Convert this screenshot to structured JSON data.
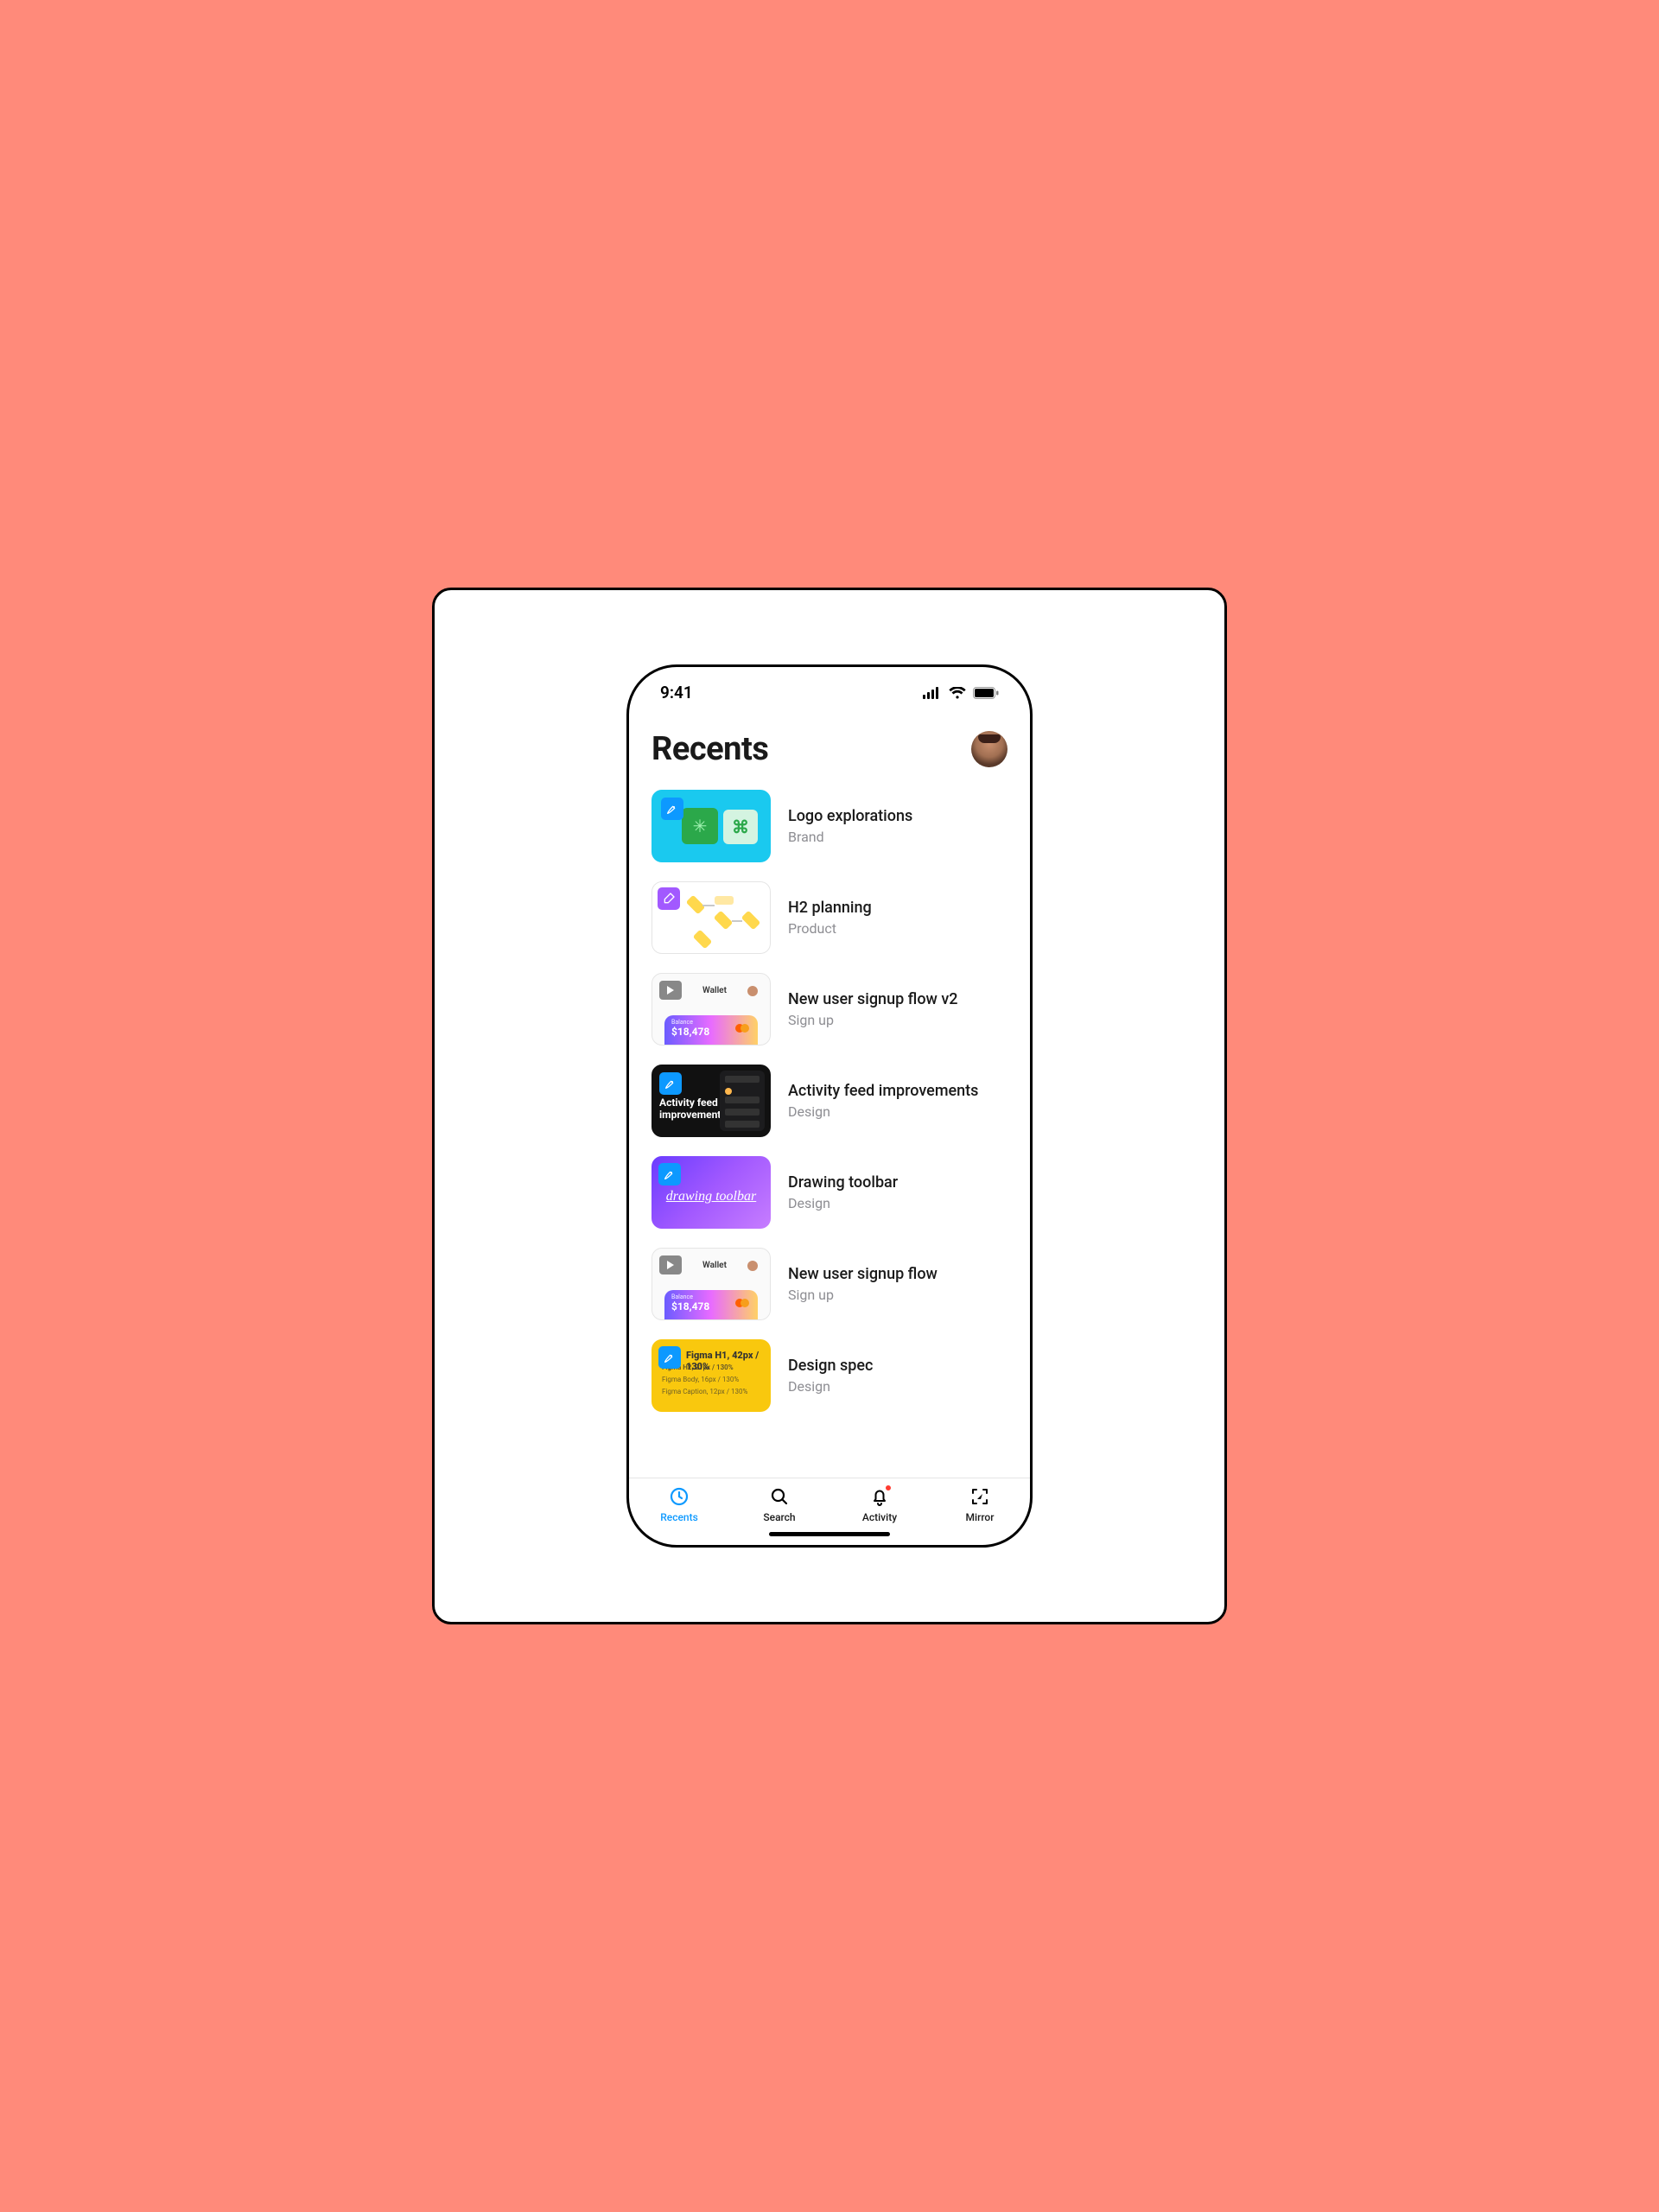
{
  "status": {
    "time": "9:41"
  },
  "header": {
    "title": "Recents"
  },
  "items": [
    {
      "title": "Logo explorations",
      "subtitle": "Brand"
    },
    {
      "title": "H2 planning",
      "subtitle": "Product"
    },
    {
      "title": "New user signup flow v2",
      "subtitle": "Sign up"
    },
    {
      "title": "Activity feed improvements",
      "subtitle": "Design"
    },
    {
      "title": "Drawing toolbar",
      "subtitle": "Design"
    },
    {
      "title": "New user signup flow",
      "subtitle": "Sign up"
    },
    {
      "title": "Design spec",
      "subtitle": "Design"
    }
  ],
  "thumb_text": {
    "wallet_label": "Wallet",
    "wallet_balance_label": "Balance",
    "wallet_amount": "$18,478",
    "activity_line1": "Activity feed",
    "activity_line2": "improvements",
    "drawing_script": "drawing toolbar",
    "spec_h1": "Figma H1, 42px / 130%",
    "spec_h2": "Figma H2, 21px / 130%",
    "spec_body": "Figma Body, 16px / 130%",
    "spec_caption": "Figma Caption, 12px / 130%"
  },
  "tabs": [
    {
      "label": "Recents",
      "active": true,
      "badge": false
    },
    {
      "label": "Search",
      "active": false,
      "badge": false
    },
    {
      "label": "Activity",
      "active": false,
      "badge": true
    },
    {
      "label": "Mirror",
      "active": false,
      "badge": false
    }
  ]
}
